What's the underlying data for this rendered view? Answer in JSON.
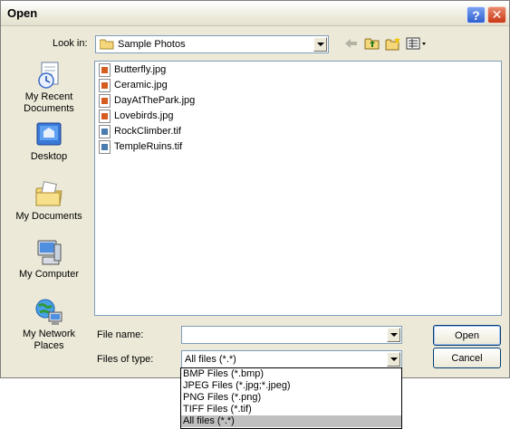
{
  "window": {
    "title": "Open"
  },
  "look_in": {
    "label": "Look in:",
    "value": "Sample Photos"
  },
  "places": [
    {
      "label": "My Recent\nDocuments",
      "icon": "recent-documents-icon"
    },
    {
      "label": "Desktop",
      "icon": "desktop-icon"
    },
    {
      "label": "My Documents",
      "icon": "my-documents-icon"
    },
    {
      "label": "My Computer",
      "icon": "my-computer-icon"
    },
    {
      "label": "My Network\nPlaces",
      "icon": "network-places-icon"
    }
  ],
  "files": [
    {
      "name": "Butterfly.jpg",
      "type": "jpg"
    },
    {
      "name": "Ceramic.jpg",
      "type": "jpg"
    },
    {
      "name": "DayAtThePark.jpg",
      "type": "jpg"
    },
    {
      "name": "Lovebirds.jpg",
      "type": "jpg"
    },
    {
      "name": "RockClimber.tif",
      "type": "tif"
    },
    {
      "name": "TempleRuins.tif",
      "type": "tif"
    }
  ],
  "file_name": {
    "label": "File name:",
    "value": ""
  },
  "files_of_type": {
    "label": "Files of type:",
    "value": "All files (*.*)",
    "options": [
      "BMP Files (*.bmp)",
      "JPEG Files (*.jpg;*.jpeg)",
      "PNG Files (*.png)",
      "TIFF Files (*.tif)",
      "All files (*.*)"
    ],
    "selected_index": 4
  },
  "buttons": {
    "open": "Open",
    "cancel": "Cancel"
  },
  "colors": {
    "dialog_bg": "#ece9d8",
    "field_border": "#7f9db9",
    "selected_option": "#c1c0c0"
  }
}
